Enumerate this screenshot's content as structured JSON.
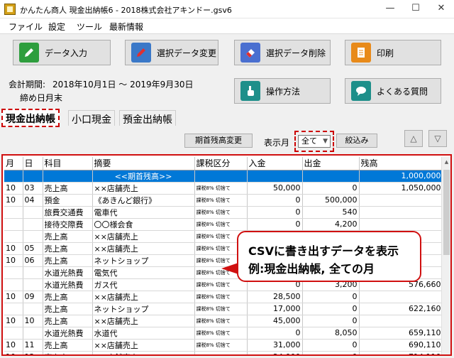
{
  "window": {
    "title": "かんたん商人 現金出納帳6 - 2018株式会社アキンドー.gsv6",
    "minimize": "—",
    "maximize": "☐",
    "close": "✕"
  },
  "menu": [
    "ファイル",
    "設定",
    "ツール",
    "最新情報"
  ],
  "toolbar": {
    "data_input": "データ入力",
    "edit_selected": "選択データ変更",
    "delete_selected": "選択データ削除",
    "print": "印刷",
    "how_to": "操作方法",
    "faq": "よくある質問"
  },
  "period": {
    "label": "会計期間:",
    "value": "2018年10月1日 〜 2019年9月30日",
    "closing_label": "締め日:",
    "closing_value": "月末"
  },
  "tabs": [
    "現金出納帳",
    "小口現金",
    "預金出納帳"
  ],
  "filter": {
    "opening_balance_button": "期首残高変更",
    "show_month_label": "表示月",
    "month_value": "全て",
    "narrow_button": "絞込み",
    "up_symbol": "△",
    "down_symbol": "▽"
  },
  "table": {
    "headers": [
      "月",
      "日",
      "科目",
      "摘要",
      "課税区分",
      "入金",
      "出金",
      "残高"
    ],
    "rows": [
      [
        "",
        "",
        "",
        "<<期首残高>>",
        "",
        "",
        "",
        "1,000,000"
      ],
      [
        "10",
        "03",
        "売上高",
        "××店舗売上",
        "課税8% 切捨て",
        "50,000",
        "0",
        "1,050,000"
      ],
      [
        "10",
        "04",
        "預金",
        "《あきんど銀行》",
        "課税8% 切捨て",
        "0",
        "500,000",
        ""
      ],
      [
        "",
        "",
        "旅費交通費",
        "電車代",
        "課税8% 切捨て",
        "0",
        "540",
        ""
      ],
      [
        "",
        "",
        "接待交際費",
        "〇〇様会食",
        "課税8% 切捨て",
        "0",
        "4,200",
        ""
      ],
      [
        "",
        "",
        "売上高",
        "××店舗売上",
        "課税8% 切捨て",
        "",
        "",
        ""
      ],
      [
        "10",
        "05",
        "売上高",
        "××店舗売上",
        "課税8% 切捨て",
        "",
        "",
        ""
      ],
      [
        "10",
        "06",
        "売上高",
        "ネットショップ",
        "課税8% 切捨て",
        "",
        "",
        ""
      ],
      [
        "",
        "",
        "水道光熱費",
        "電気代",
        "課税8% 切捨て",
        "",
        "",
        ""
      ],
      [
        "",
        "",
        "水道光熱費",
        "ガス代",
        "課税8% 切捨て",
        "0",
        "3,200",
        "576,660"
      ],
      [
        "10",
        "09",
        "売上高",
        "××店舗売上",
        "課税8% 切捨て",
        "28,500",
        "0",
        ""
      ],
      [
        "",
        "",
        "売上高",
        "ネットショップ",
        "課税8% 切捨て",
        "17,000",
        "0",
        "622,160"
      ],
      [
        "10",
        "10",
        "売上高",
        "××店舗売上",
        "課税8% 切捨て",
        "45,000",
        "0",
        ""
      ],
      [
        "",
        "",
        "水道光熱費",
        "水道代",
        "課税8% 切捨て",
        "0",
        "8,050",
        "659,110"
      ],
      [
        "10",
        "11",
        "売上高",
        "××店舗売上",
        "課税8% 切捨て",
        "31,000",
        "0",
        "690,110"
      ],
      [
        "10",
        "12",
        "売上高",
        "××店舗売上",
        "課税8% 切捨て",
        "24,000",
        "0",
        "714,110"
      ]
    ]
  },
  "callout": {
    "line1": "CSVに書き出すデータを表示",
    "line2": "例:現金出納帳, 全ての月"
  },
  "colors": {
    "selection": "#0078d7",
    "highlight_border": "#d01010",
    "icon_data_input": "#2e9e3e",
    "icon_edit": "#3a78c8",
    "icon_delete": "#4a6fd0",
    "icon_print": "#e88a1a",
    "icon_how_to": "#1e8f8a",
    "icon_faq": "#1e8f8a"
  },
  "icons": {
    "data_input": "pencil-icon",
    "edit_selected": "edit-pencil-icon",
    "delete_selected": "eraser-icon",
    "print": "document-icon",
    "how_to": "hand-pointer-icon",
    "faq": "speech-bubble-icon"
  }
}
